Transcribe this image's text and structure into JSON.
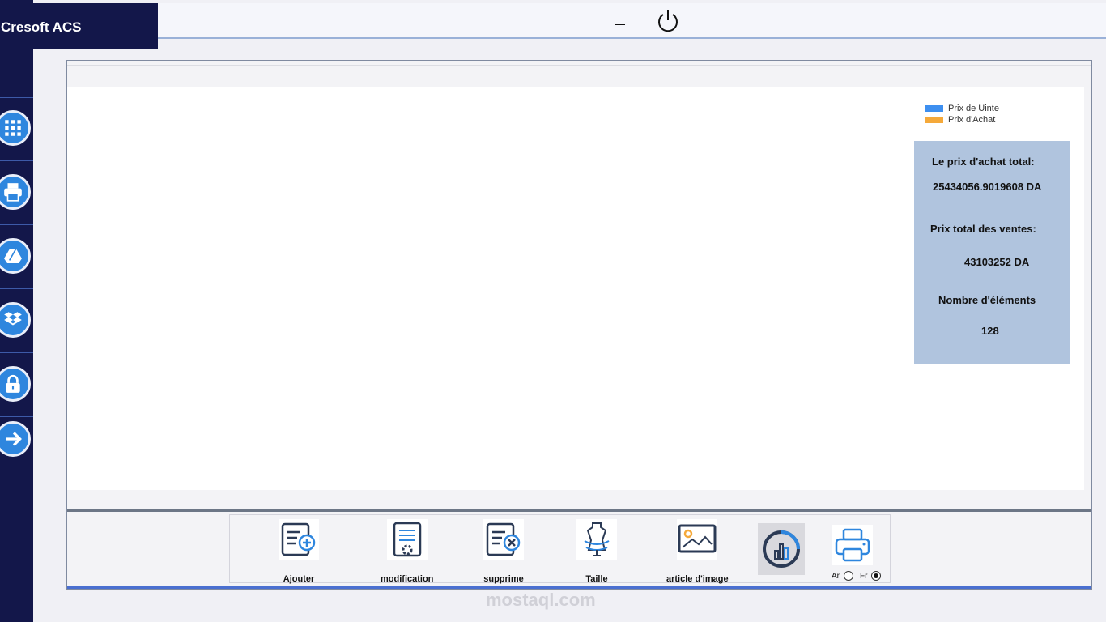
{
  "app": {
    "title": "Cresoft ACS"
  },
  "window": {
    "minimize_label": "–"
  },
  "sidebar": {
    "items": [
      {
        "name": "apps",
        "icon": "grid-icon"
      },
      {
        "name": "print",
        "icon": "printer-icon"
      },
      {
        "name": "drive",
        "icon": "google-drive-icon"
      },
      {
        "name": "dropbox",
        "icon": "dropbox-icon"
      },
      {
        "name": "lock",
        "icon": "lock-icon"
      },
      {
        "name": "next",
        "icon": "arrow-right-icon"
      }
    ]
  },
  "chart": {
    "legend": [
      {
        "label": "Prix de Uinte",
        "color": "#3d8ff0"
      },
      {
        "label": "Prix d'Achat",
        "color": "#f5a93a"
      }
    ]
  },
  "stats": {
    "purchase_total_label": "Le prix d'achat total:",
    "purchase_total_value": "25434056.9019608 DA",
    "sales_total_label": "Prix total des ventes:",
    "sales_total_value": "43103252 DA",
    "items_count_label": "Nombre d'éléments",
    "items_count_value": "128"
  },
  "toolbar": {
    "add_label": "Ajouter",
    "edit_label": "modification",
    "delete_label": "supprime",
    "size_label": "Taille",
    "image_label": "article d'image",
    "lang_ar": "Ar",
    "lang_fr": "Fr",
    "lang_selected": "Fr"
  },
  "watermark": "mostaql.com",
  "colors": {
    "sidebar": "#13174a",
    "accent": "#2e86de",
    "stats_bg": "#b0c4de"
  }
}
